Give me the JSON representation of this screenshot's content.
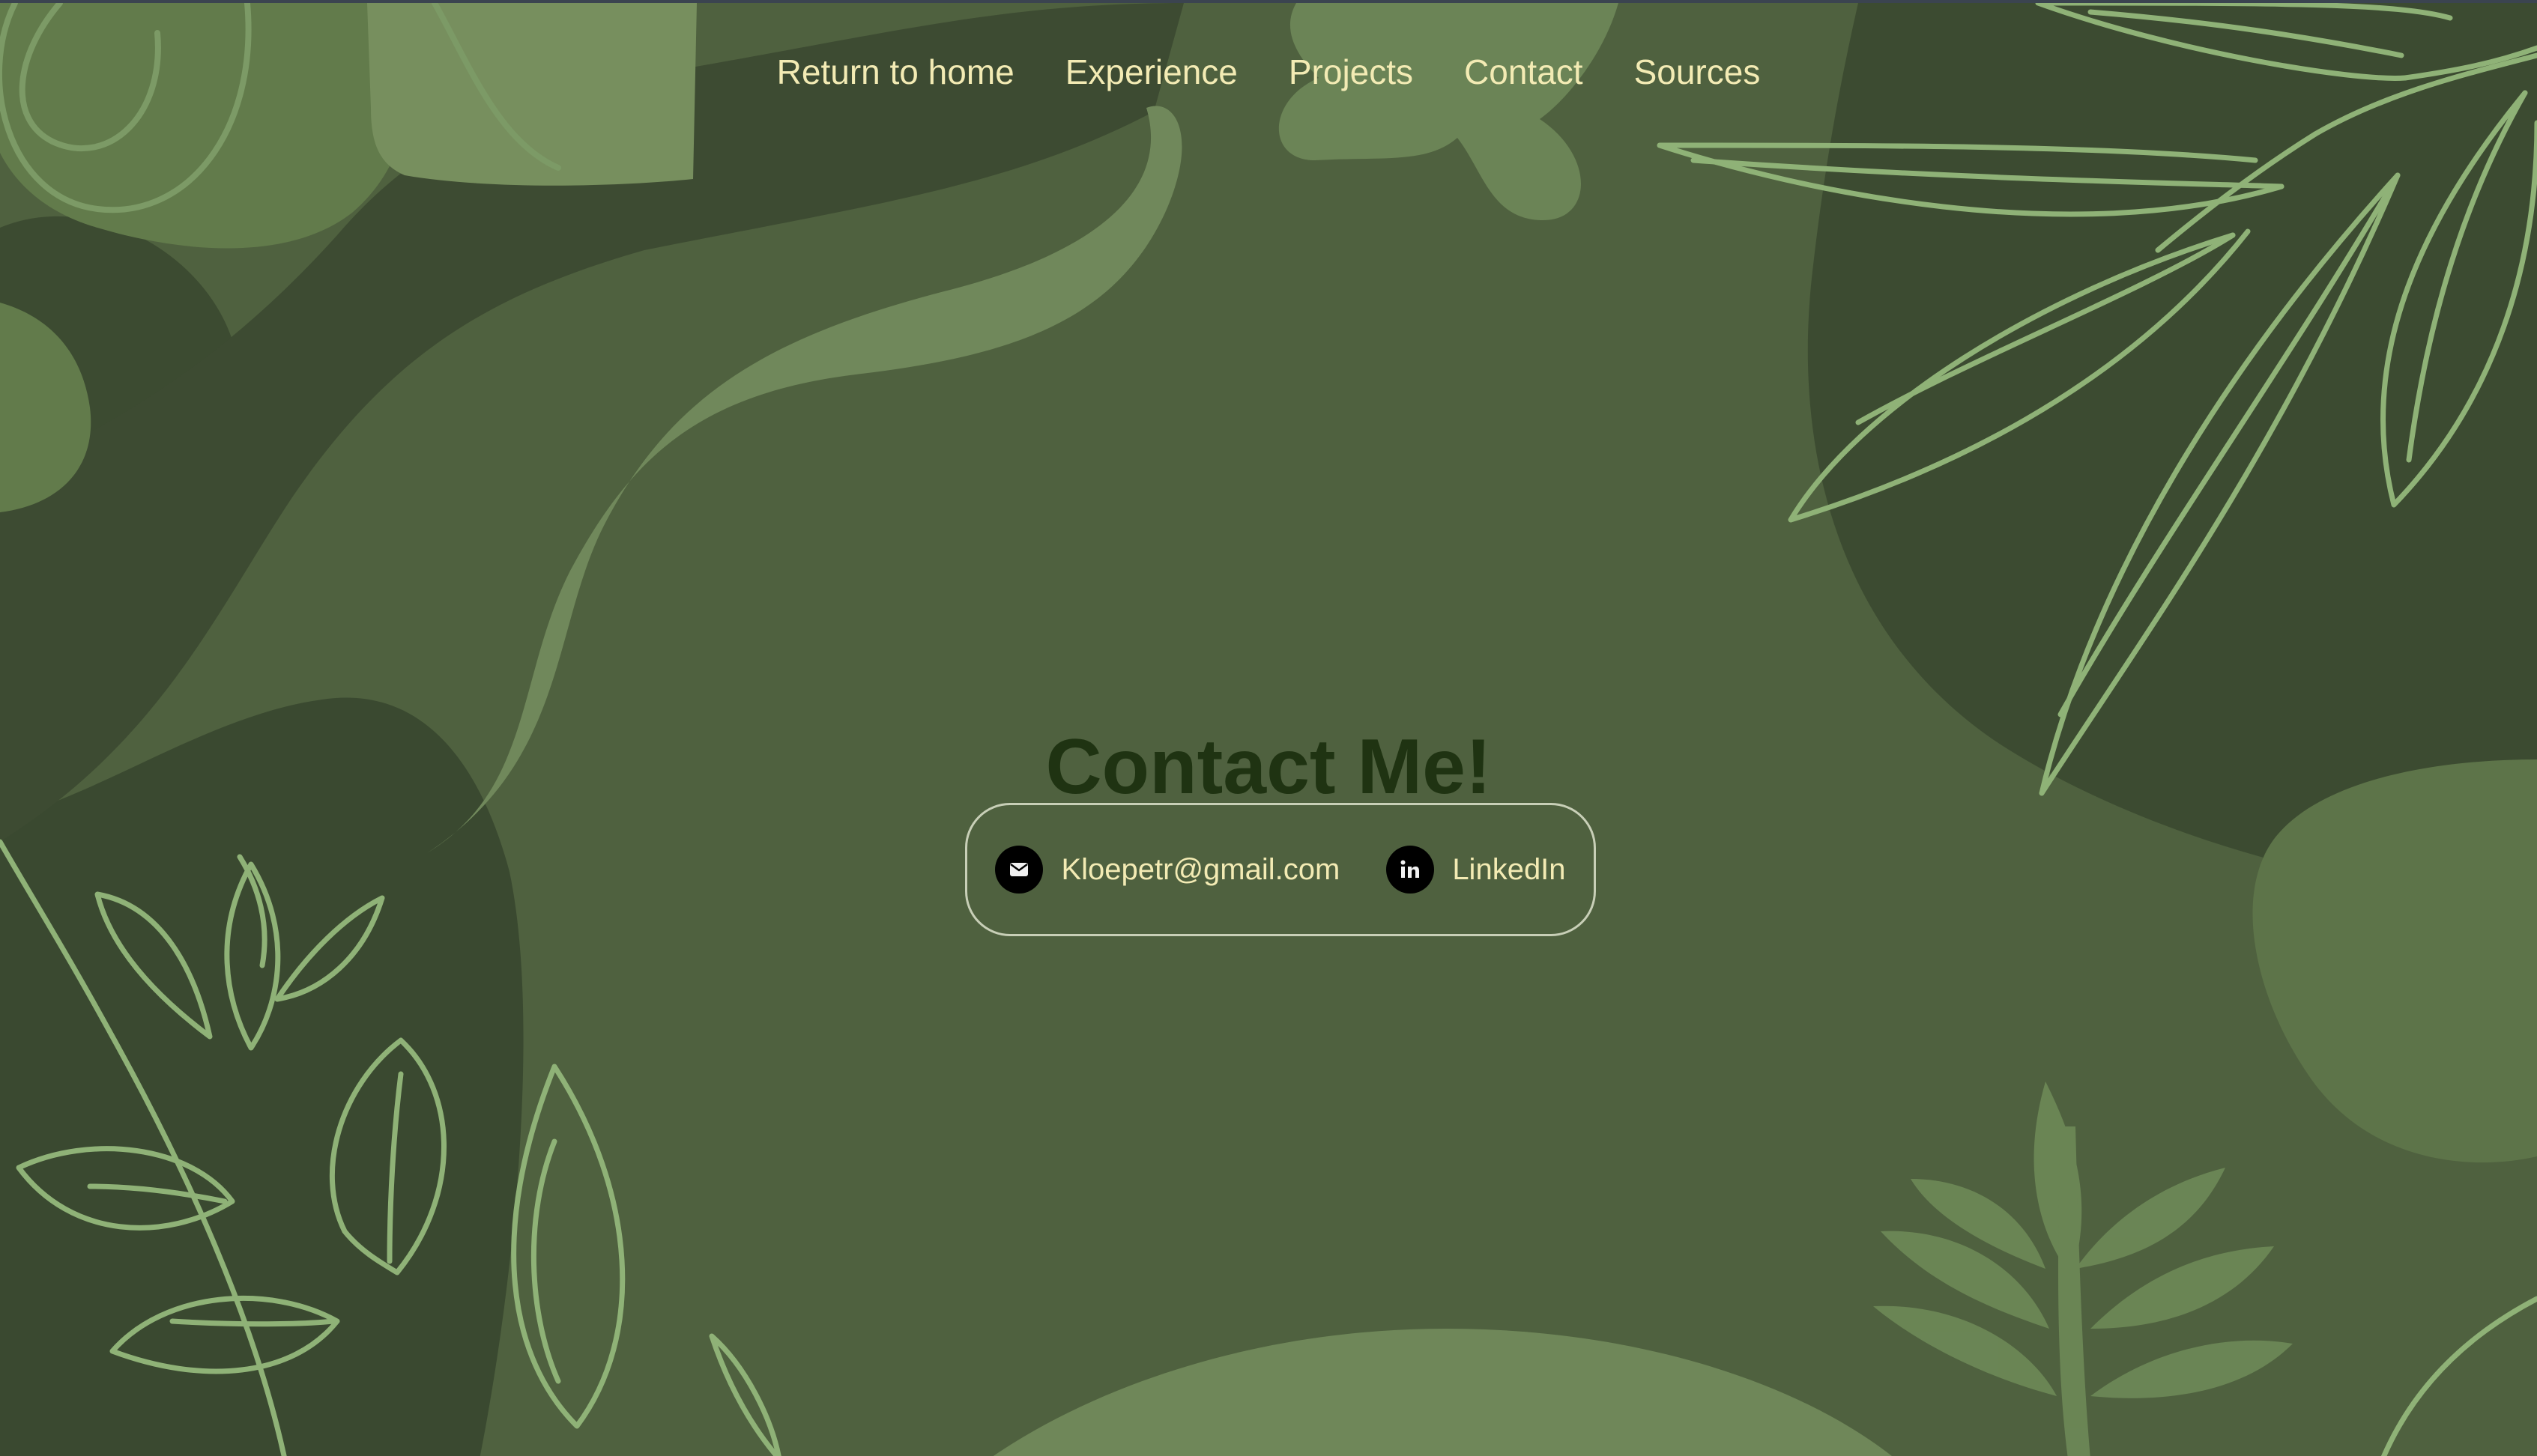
{
  "nav": {
    "items": [
      {
        "label": "Return to home"
      },
      {
        "label": "Experience"
      },
      {
        "label": "Projects"
      },
      {
        "label": "Contact"
      },
      {
        "label": "Sources"
      }
    ]
  },
  "main": {
    "title": "Contact Me!",
    "contacts": [
      {
        "label": "Kloepetr@gmail.com",
        "icon": "mail-icon"
      },
      {
        "label": "LinkedIn",
        "icon": "linkedin-icon"
      }
    ]
  },
  "colors": {
    "background": "#4f613f",
    "text_accent": "#f3ebb4",
    "title": "#1f3312",
    "dark_shape": "#3c4b31",
    "light_shape": "#77905f",
    "line_art": "#8fb277"
  }
}
